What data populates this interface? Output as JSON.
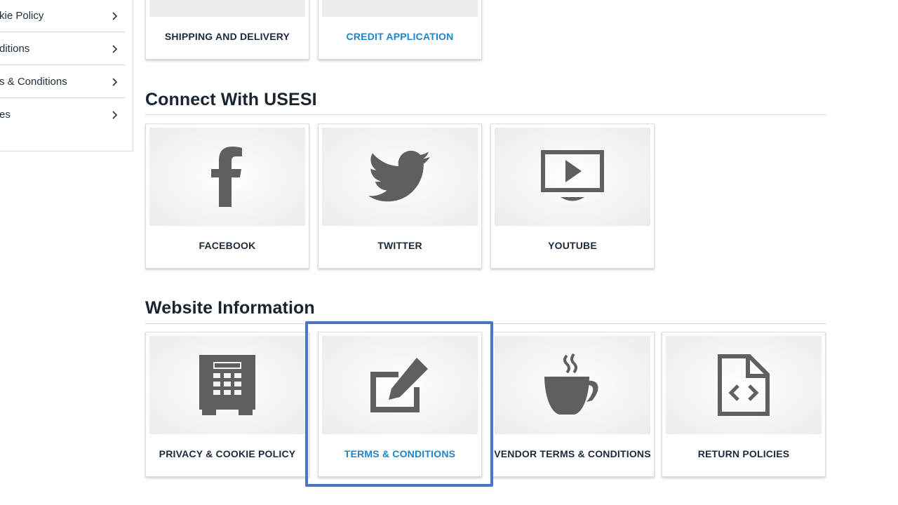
{
  "sidebar": {
    "items": [
      {
        "label": "kie Policy"
      },
      {
        "label": "ditions"
      },
      {
        "label": "s & Conditions"
      },
      {
        "label": "es"
      }
    ]
  },
  "top_cards": [
    {
      "label": "SHIPPING AND DELIVERY"
    },
    {
      "label": "CREDIT APPLICATION"
    }
  ],
  "connect": {
    "title": "Connect With USESI",
    "cards": [
      {
        "label": "FACEBOOK",
        "icon": "facebook-icon"
      },
      {
        "label": "TWITTER",
        "icon": "twitter-icon"
      },
      {
        "label": "YOUTUBE",
        "icon": "youtube-icon"
      }
    ]
  },
  "website_info": {
    "title": "Website Information",
    "cards": [
      {
        "label": "PRIVACY & COOKIE POLICY",
        "icon": "safe-icon"
      },
      {
        "label": "TERMS & CONDITIONS",
        "icon": "edit-icon"
      },
      {
        "label": "VENDOR TERMS & CONDITIONS",
        "icon": "coffee-icon"
      },
      {
        "label": "RETURN POLICIES",
        "icon": "code-file-icon"
      }
    ]
  },
  "colors": {
    "icon": "#5f5f5f",
    "link": "#1f84c9",
    "highlight": "#4e74c4",
    "heading": "#1a2330"
  }
}
